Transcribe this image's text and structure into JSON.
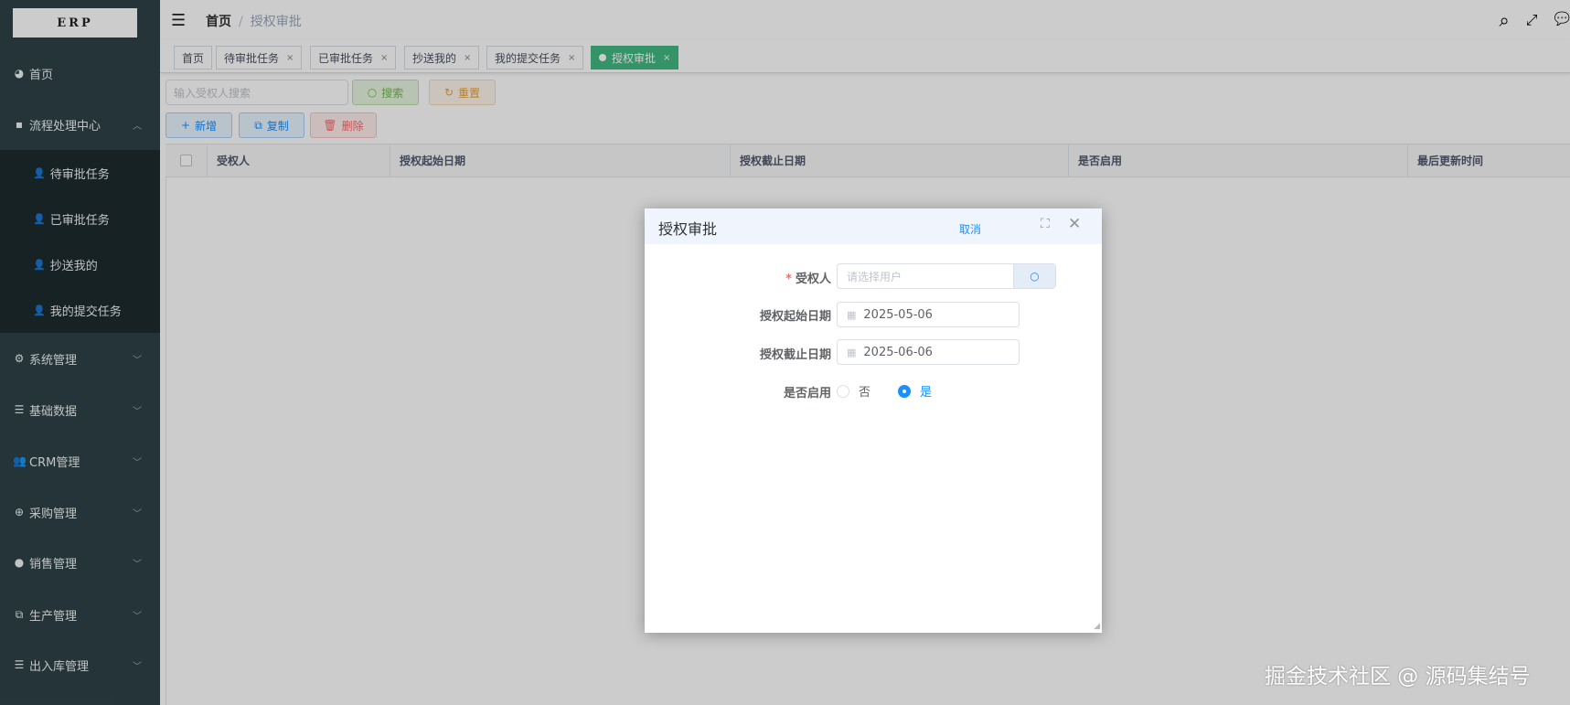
{
  "logo": "ERP",
  "sidebar": {
    "items": [
      {
        "label": "首页",
        "icon": "dashboard-icon"
      },
      {
        "label": "流程处理中心",
        "icon": "comment-icon",
        "expanded": true,
        "children": [
          "待审批任务",
          "已审批任务",
          "抄送我的",
          "我的提交任务"
        ]
      },
      {
        "label": "系统管理",
        "icon": "gear-icon"
      },
      {
        "label": "基础数据",
        "icon": "database-icon"
      },
      {
        "label": "CRM管理",
        "icon": "users-icon"
      },
      {
        "label": "采购管理",
        "icon": "globe-icon"
      },
      {
        "label": "销售管理",
        "icon": "earth-icon"
      },
      {
        "label": "生产管理",
        "icon": "puzzle-icon"
      },
      {
        "label": "出入库管理",
        "icon": "database-icon"
      }
    ]
  },
  "breadcrumb": {
    "home": "首页",
    "current": "授权审批"
  },
  "tabs": [
    {
      "label": "首页"
    },
    {
      "label": "待审批任务"
    },
    {
      "label": "已审批任务"
    },
    {
      "label": "抄送我的"
    },
    {
      "label": "我的提交任务"
    },
    {
      "label": "授权审批",
      "active": true
    }
  ],
  "toolbar": {
    "search_placeholder": "输入受权人搜索",
    "search": "搜索",
    "reset": "重置",
    "add": "新增",
    "copy": "复制",
    "delete": "删除"
  },
  "table": {
    "columns": [
      "受权人",
      "授权起始日期",
      "授权截止日期",
      "是否启用",
      "最后更新时间"
    ]
  },
  "modal": {
    "title": "授权审批",
    "cancel": "取消",
    "fields": {
      "grantee_label": "受权人",
      "grantee_placeholder": "请选择用户",
      "start_label": "授权起始日期",
      "start_value": "2025-05-06",
      "end_label": "授权截止日期",
      "end_value": "2025-06-06",
      "enabled_label": "是否启用",
      "opt_no": "否",
      "opt_yes": "是",
      "enabled": "是"
    }
  },
  "watermark": "掘金技术社区 @ 源码集结号"
}
